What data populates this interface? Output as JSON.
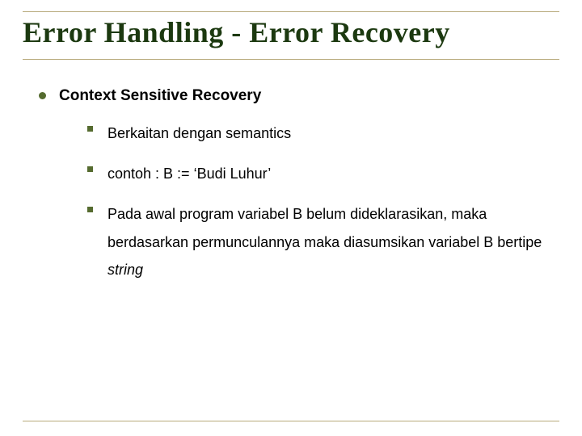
{
  "title": "Error Handling - Error Recovery",
  "top": {
    "heading": "Context Sensitive Recovery"
  },
  "items": [
    {
      "text": "Berkaitan dengan semantics"
    },
    {
      "text": "contoh  : B := ‘Budi Luhur’"
    },
    {
      "text_pre": "Pada awal program variabel B belum dideklarasikan, maka berdasarkan permunculannya maka diasumsikan variabel B bertipe ",
      "italic": "string"
    }
  ]
}
